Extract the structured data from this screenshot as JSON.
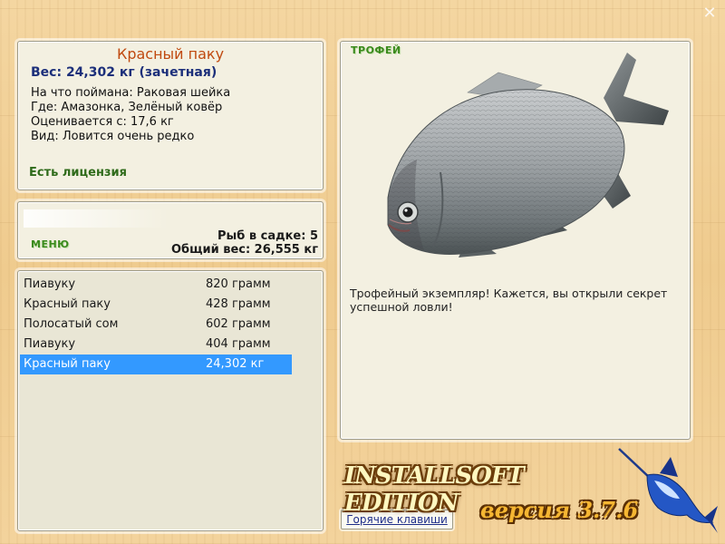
{
  "window": {
    "close_icon": "close-x-icon"
  },
  "catch": {
    "name": "Красный паку",
    "weight_line": "Вес: 24,302 кг (зачетная)",
    "bait": "На что поймана: Раковая шейка",
    "place": "Где: Амазонка, Зелёный ковёр",
    "valued": "Оценивается с: 17,6 кг",
    "rarity": "Вид: Ловится очень редко",
    "license": "Есть лицензия"
  },
  "menu": {
    "label": "МЕНЮ",
    "fish_count": "Рыб в садке: 5",
    "total_weight": "Общий вес: 26,555 кг"
  },
  "list": {
    "rows": [
      {
        "name": "Пиавуку",
        "weight": "820 грамм"
      },
      {
        "name": "Красный паку",
        "weight": "428 грамм"
      },
      {
        "name": "Полосатый сом",
        "weight": "602 грамм"
      },
      {
        "name": "Пиавуку",
        "weight": "404 грамм"
      },
      {
        "name": "Красный паку",
        "weight": "24,302 кг"
      }
    ],
    "selected_index": 4
  },
  "hotkeys_label": "Горячие клавиши",
  "trophy": {
    "title": "ТРОФЕЙ",
    "image": "red-pacu-fish-image",
    "text": "Трофейный экземпляр! Кажется, вы открыли секрет успешной ловли!"
  },
  "logo": {
    "text": "INSTALLSOFT EDITION",
    "version": "версия 3.7.6",
    "icon": "marlin-icon"
  },
  "colors": {
    "accent_name": "#c04a10",
    "weight_blue": "#1c2f7a",
    "license_green": "#2f6b1b",
    "selection": "#3399ff"
  }
}
